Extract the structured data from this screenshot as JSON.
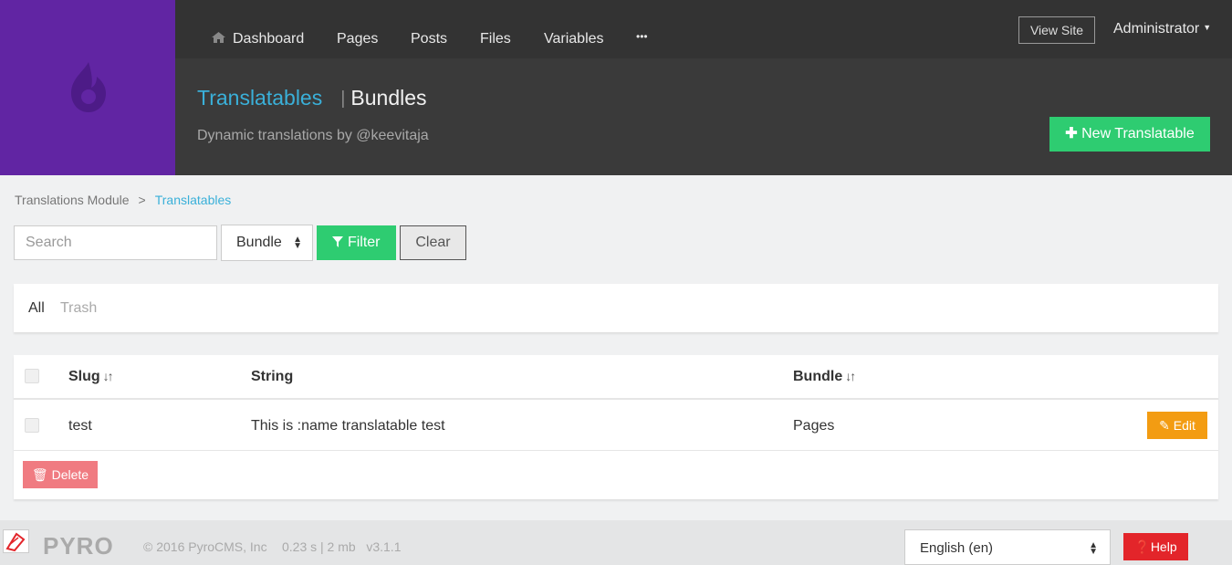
{
  "nav": {
    "items": [
      {
        "label": "Dashboard",
        "icon": "home-icon"
      },
      {
        "label": "Pages"
      },
      {
        "label": "Posts"
      },
      {
        "label": "Files"
      },
      {
        "label": "Variables"
      },
      {
        "label": "•••"
      }
    ],
    "view_site": "View Site",
    "user": "Administrator"
  },
  "header": {
    "title": "Translatables",
    "secondary": "Bundles",
    "subtitle": "Dynamic translations by @keevitaja",
    "new_button": "New Translatable"
  },
  "breadcrumb": {
    "items": [
      "Translations Module",
      "Translatables"
    ],
    "separator": ">"
  },
  "filters": {
    "search_placeholder": "Search",
    "bundle_select": "Bundle",
    "filter_button": "Filter",
    "clear_button": "Clear"
  },
  "tabs": [
    {
      "label": "All",
      "active": true
    },
    {
      "label": "Trash",
      "active": false
    }
  ],
  "table": {
    "columns": [
      "Slug",
      "String",
      "Bundle"
    ],
    "rows": [
      {
        "slug": "test",
        "string": "This is :name translatable test",
        "bundle": "Pages",
        "action": "Edit"
      }
    ],
    "delete_button": "Delete"
  },
  "footer": {
    "logo": "PYRO",
    "copyright": "© 2016 PyroCMS, Inc",
    "stats": "0.23 s | 2 mb   v3.1.1",
    "language": "English (en)",
    "help": "Help"
  },
  "colors": {
    "brand_purple": "#6125a3",
    "accent_blue": "#3ab0d9",
    "success_green": "#2ecc71",
    "warning_orange": "#f39c12",
    "danger_red": "#e3252a"
  }
}
